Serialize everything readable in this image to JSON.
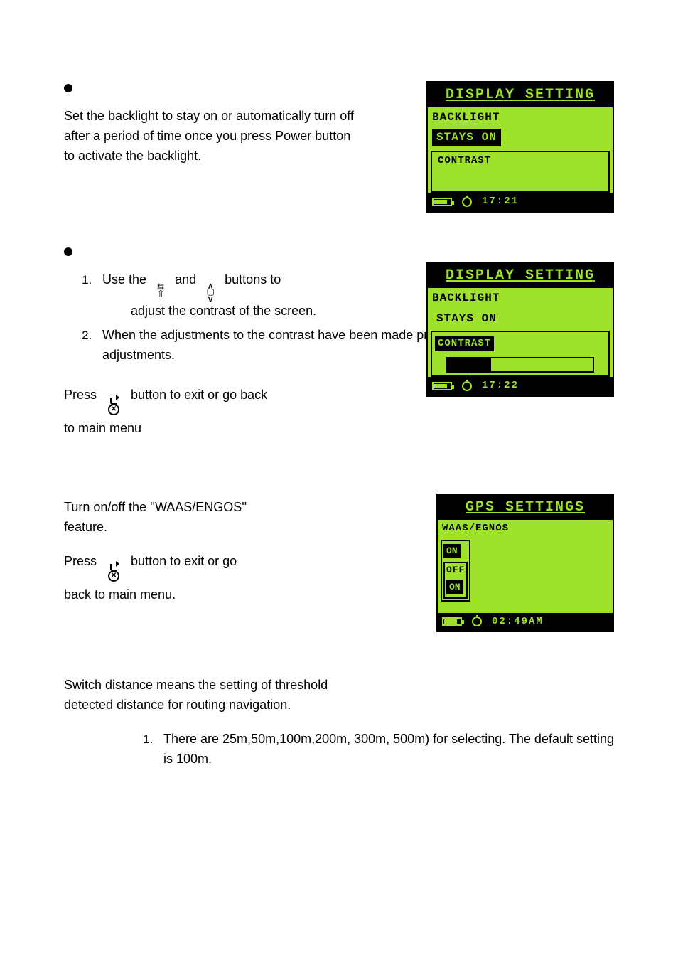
{
  "sec1": {
    "text": "Set the backlight to stay on or automatically turn off after a period of time once you press Power button to activate the backlight."
  },
  "sec2": {
    "li1_a": "Use the",
    "li1_b": "and",
    "li1_c": "buttons to",
    "li1_cont": "adjust the contrast of the screen.",
    "li2": "When the adjustments to the contrast have been made press the \"    \" button to accept the adjustments.",
    "press_a": "Press",
    "press_b": "button to exit or go back",
    "press_c": "to main menu"
  },
  "sec3": {
    "p1": "Turn on/off the ''WAAS/ENGOS'' feature.",
    "press_a": "Press",
    "press_b": "button to exit or go",
    "press_c": "back to main menu."
  },
  "sec4": {
    "p1": "Switch distance means the setting of threshold detected distance for routing navigation.",
    "li1": "There are 25m,50m,100m,200m, 300m, 500m) for selecting. The default setting is 100m."
  },
  "lcd1": {
    "title": "DISPLAY SETTING",
    "row1": "BACKLIGHT",
    "row2": "STAYS ON",
    "row3": "CONTRAST",
    "time": "17:21"
  },
  "lcd2": {
    "title": "DISPLAY SETTING",
    "row1": "BACKLIGHT",
    "row2": "STAYS ON",
    "row3": "CONTRAST",
    "time": "17:22"
  },
  "lcd3": {
    "title": "GPS SETTINGS",
    "row1": "WAAS/EGNOS",
    "on1": "ON",
    "off": "OFF",
    "on2": "ON",
    "time": "02:49AM"
  }
}
